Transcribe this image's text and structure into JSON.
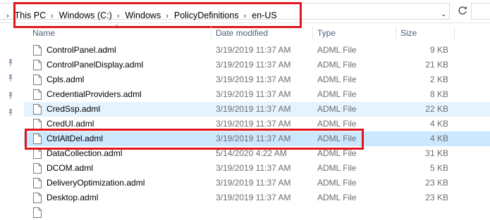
{
  "address": {
    "crumbs": [
      "This PC",
      "Windows (C:)",
      "Windows",
      "PolicyDefinitions",
      "en-US"
    ]
  },
  "columns": {
    "name": "Name",
    "date": "Date modified",
    "type": "Type",
    "size": "Size"
  },
  "files": [
    {
      "name": "ControlPanel.adml",
      "date": "3/19/2019 11:37 AM",
      "type": "ADML File",
      "size": "9 KB"
    },
    {
      "name": "ControlPanelDisplay.adml",
      "date": "3/19/2019 11:37 AM",
      "type": "ADML File",
      "size": "21 KB"
    },
    {
      "name": "Cpls.adml",
      "date": "3/19/2019 11:37 AM",
      "type": "ADML File",
      "size": "2 KB"
    },
    {
      "name": "CredentialProviders.adml",
      "date": "3/19/2019 11:37 AM",
      "type": "ADML File",
      "size": "8 KB"
    },
    {
      "name": "CredSsp.adml",
      "date": "3/19/2019 11:37 AM",
      "type": "ADML File",
      "size": "22 KB"
    },
    {
      "name": "CredUI.adml",
      "date": "3/19/2019 11:37 AM",
      "type": "ADML File",
      "size": "4 KB"
    },
    {
      "name": "CtrlAltDel.adml",
      "date": "3/19/2019 11:37 AM",
      "type": "ADML File",
      "size": "4 KB"
    },
    {
      "name": "DataCollection.adml",
      "date": "5/14/2020 4:22 AM",
      "type": "ADML File",
      "size": "31 KB"
    },
    {
      "name": "DCOM.adml",
      "date": "3/19/2019 11:37 AM",
      "type": "ADML File",
      "size": "5 KB"
    },
    {
      "name": "DeliveryOptimization.adml",
      "date": "3/19/2019 11:37 AM",
      "type": "ADML File",
      "size": "23 KB"
    },
    {
      "name": "Desktop.adml",
      "date": "3/19/2019 11:37 AM",
      "type": "ADML File",
      "size": "23 KB"
    },
    {
      "name": "",
      "date": "",
      "type": "",
      "size": ""
    }
  ],
  "colors": {
    "selected_row": "#cce8ff",
    "hover_row": "#e5f3ff",
    "highlight_box": "#e0161c",
    "header_text": "#4c607a"
  },
  "icons": {
    "file": "document-icon",
    "pin": "pin-icon",
    "refresh": "refresh-icon"
  }
}
